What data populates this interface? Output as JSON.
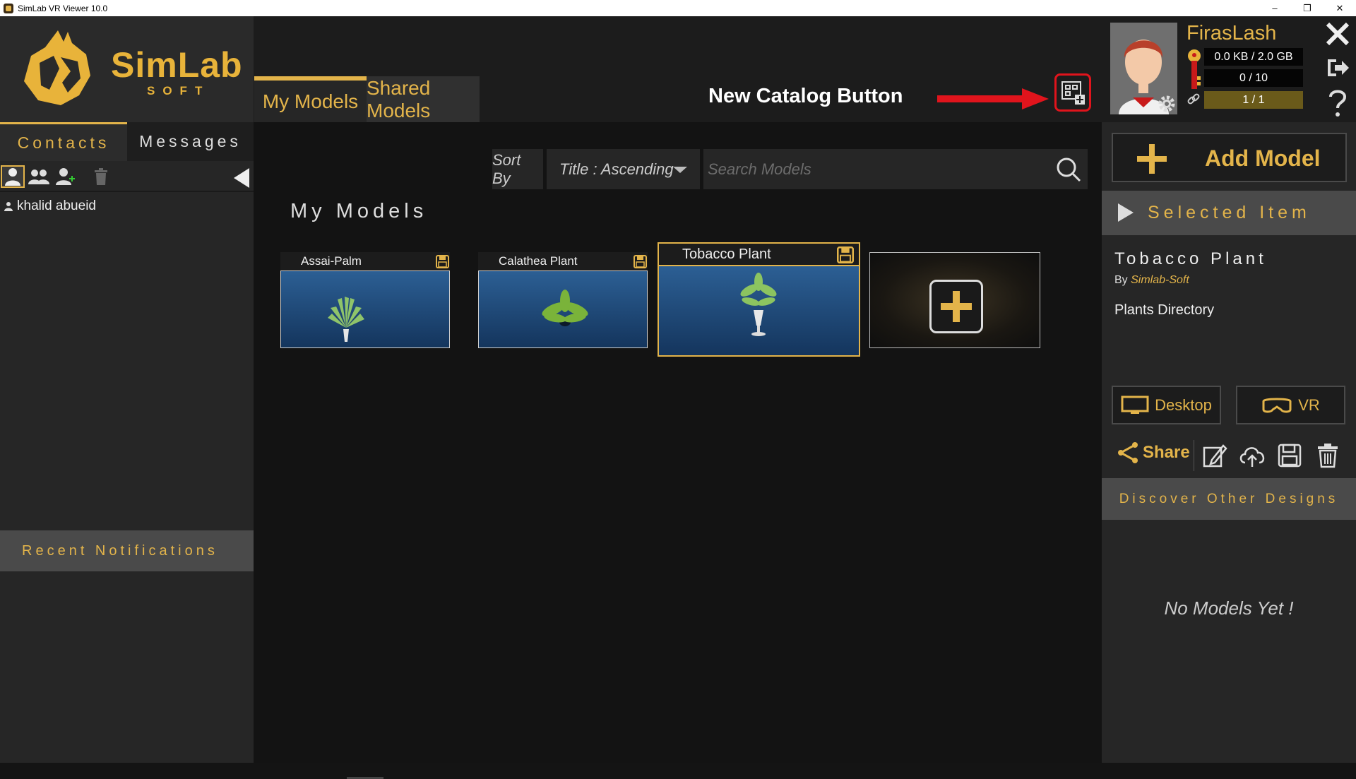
{
  "window": {
    "title": "SimLab VR Viewer 10.0",
    "minimize": "–",
    "restore": "❐",
    "close": "✕"
  },
  "logo": {
    "brand": "SimLab",
    "sub": "SOFT"
  },
  "left_panel": {
    "tabs": [
      "Contacts",
      "Messages"
    ],
    "active_tab": "Contacts",
    "tools": [
      "single-user-icon",
      "group-icon",
      "add-contact-icon",
      "trash-icon"
    ],
    "contacts": [
      {
        "name": "khalid abueid"
      }
    ],
    "notifications_label": "Recent Notifications"
  },
  "center": {
    "tabs": [
      "My Models",
      "Shared Models"
    ],
    "active_tab": "My Models",
    "annotation": {
      "label": "New Catalog Button",
      "arrow_color": "#e0141c"
    },
    "sort": {
      "label": "Sort By",
      "value": "Title : Ascending"
    },
    "search": {
      "placeholder": "Search Models",
      "value": ""
    },
    "section_title": "My Models",
    "models": [
      {
        "title": "Assai-Palm",
        "selected": false
      },
      {
        "title": "Calathea Plant",
        "selected": false
      },
      {
        "title": "Tobacco Plant",
        "selected": true
      }
    ]
  },
  "right_panel": {
    "user": {
      "name": "FirasLash",
      "storage": "0.0 KB / 2.0 GB",
      "models_count": "0 / 10",
      "license": "1 / 1"
    },
    "add_model_label": "Add Model",
    "selected_header": "Selected Item",
    "selected": {
      "title": "Tobacco Plant",
      "by_prefix": "By",
      "author": "Simlab-Soft",
      "directory": "Plants Directory"
    },
    "modes": [
      "Desktop",
      "VR"
    ],
    "share_label": "Share",
    "discover_label": "Discover Other Designs",
    "discover_empty": "No Models Yet !"
  },
  "colors": {
    "accent": "#e3b44a",
    "panel": "#262626",
    "background": "#131313",
    "annotation_red": "#e0141c"
  }
}
